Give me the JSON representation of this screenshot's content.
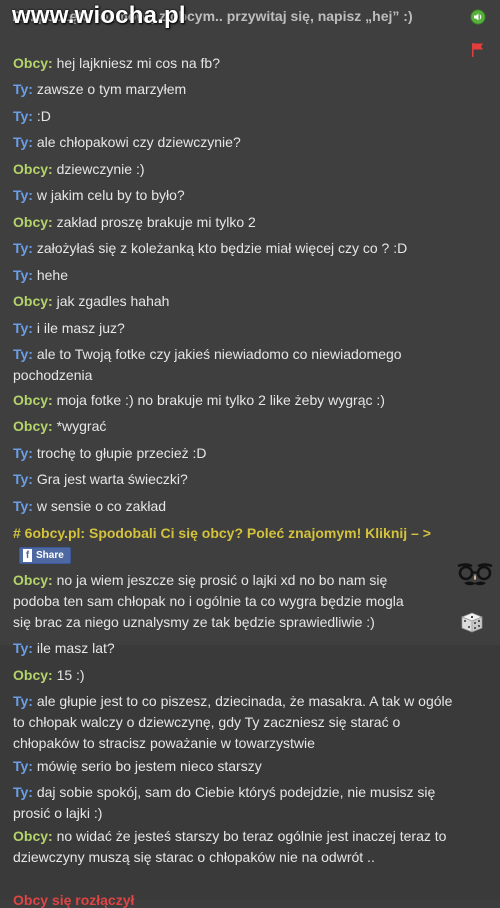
{
  "watermark": "www.wiocha.pl",
  "intro": "Rozpoczęto rozmowę z obcym.. przywitaj się, napisz „hej” :)",
  "messages": [
    {
      "who": "Obcy:",
      "text": "hej lajkniesz mi cos na fb?"
    },
    {
      "who": "Ty:",
      "text": "zawsze o tym marzyłem"
    },
    {
      "who": "Ty:",
      "text": ":D"
    },
    {
      "who": "Ty:",
      "text": "ale chłopakowi czy dziewczynie?"
    },
    {
      "who": "Obcy:",
      "text": "dziewczynie :)"
    },
    {
      "who": "Ty:",
      "text": "w jakim celu by to było?"
    },
    {
      "who": "Obcy:",
      "text": "zakład proszę brakuje mi tylko 2"
    },
    {
      "who": "Ty:",
      "text": "założyłaś się z koleżanką kto będzie miał więcej czy co ? :D"
    },
    {
      "who": "Ty:",
      "text": "hehe"
    },
    {
      "who": "Obcy:",
      "text": "jak zgadles hahah"
    },
    {
      "who": "Ty:",
      "text": "i ile masz juz?"
    },
    {
      "who": "Ty:",
      "text": "ale to Twoją fotke czy jakieś niewiadomo co niewiadomego pochodzenia"
    },
    {
      "who": "Obcy:",
      "text": "moja fotke :) no brakuje mi tylko 2 like żeby wygrąc :)"
    },
    {
      "who": "Obcy:",
      "text": "*wygrać"
    },
    {
      "who": "Ty:",
      "text": "trochę to głupie przecież :D"
    },
    {
      "who": "Ty:",
      "text": "Gra jest warta świeczki?"
    },
    {
      "who": "Ty:",
      "text": "w sensie o co zakład"
    },
    {
      "who": "Obcy:",
      "text": "no ja wiem jeszcze się prosić o lajki xd no bo nam się podoba ten sam chłopak no i ogólnie ta co wygra będzie mogla się brac za niego uznalysmy ze tak będzie sprawiedliwie :)"
    },
    {
      "who": "Ty:",
      "text": "ile masz lat?"
    },
    {
      "who": "Obcy:",
      "text": "15 :)"
    },
    {
      "who": "Ty:",
      "text": "ale głupie jest to co piszesz, dziecinada, że masakra. A tak w ogóle to chłopak walczy o dziewczynę, gdy Ty zaczniesz się starać o chłopaków to stracisz poważanie w towarzystwie"
    },
    {
      "who": "Ty:",
      "text": "mówię serio bo jestem nieco starszy"
    },
    {
      "who": "Ty:",
      "text": "daj sobie spokój, sam do Ciebie któryś podejdzie, nie musisz się prosić o lajki :)"
    },
    {
      "who": "Obcy:",
      "text": "no widać że jesteś starszy bo teraz ogólnie jest inaczej teraz to dziewczyny muszą się starac o chłopaków nie na odwrót .."
    }
  ],
  "system": {
    "text": "# 6obcy.pl: Spodobali Ci się obcy? Poleć znajomym! Kliknij – >",
    "share_label": "Share"
  },
  "ending": "Obcy się rozłączył",
  "colors": {
    "obcy": "#b4d36a",
    "ty": "#6a9ee6",
    "system": "#d4c23c",
    "background": "#3f3f3f"
  },
  "icons": [
    "sound-icon",
    "report-flag-icon",
    "disguise-glasses-icon",
    "dice-icon"
  ]
}
